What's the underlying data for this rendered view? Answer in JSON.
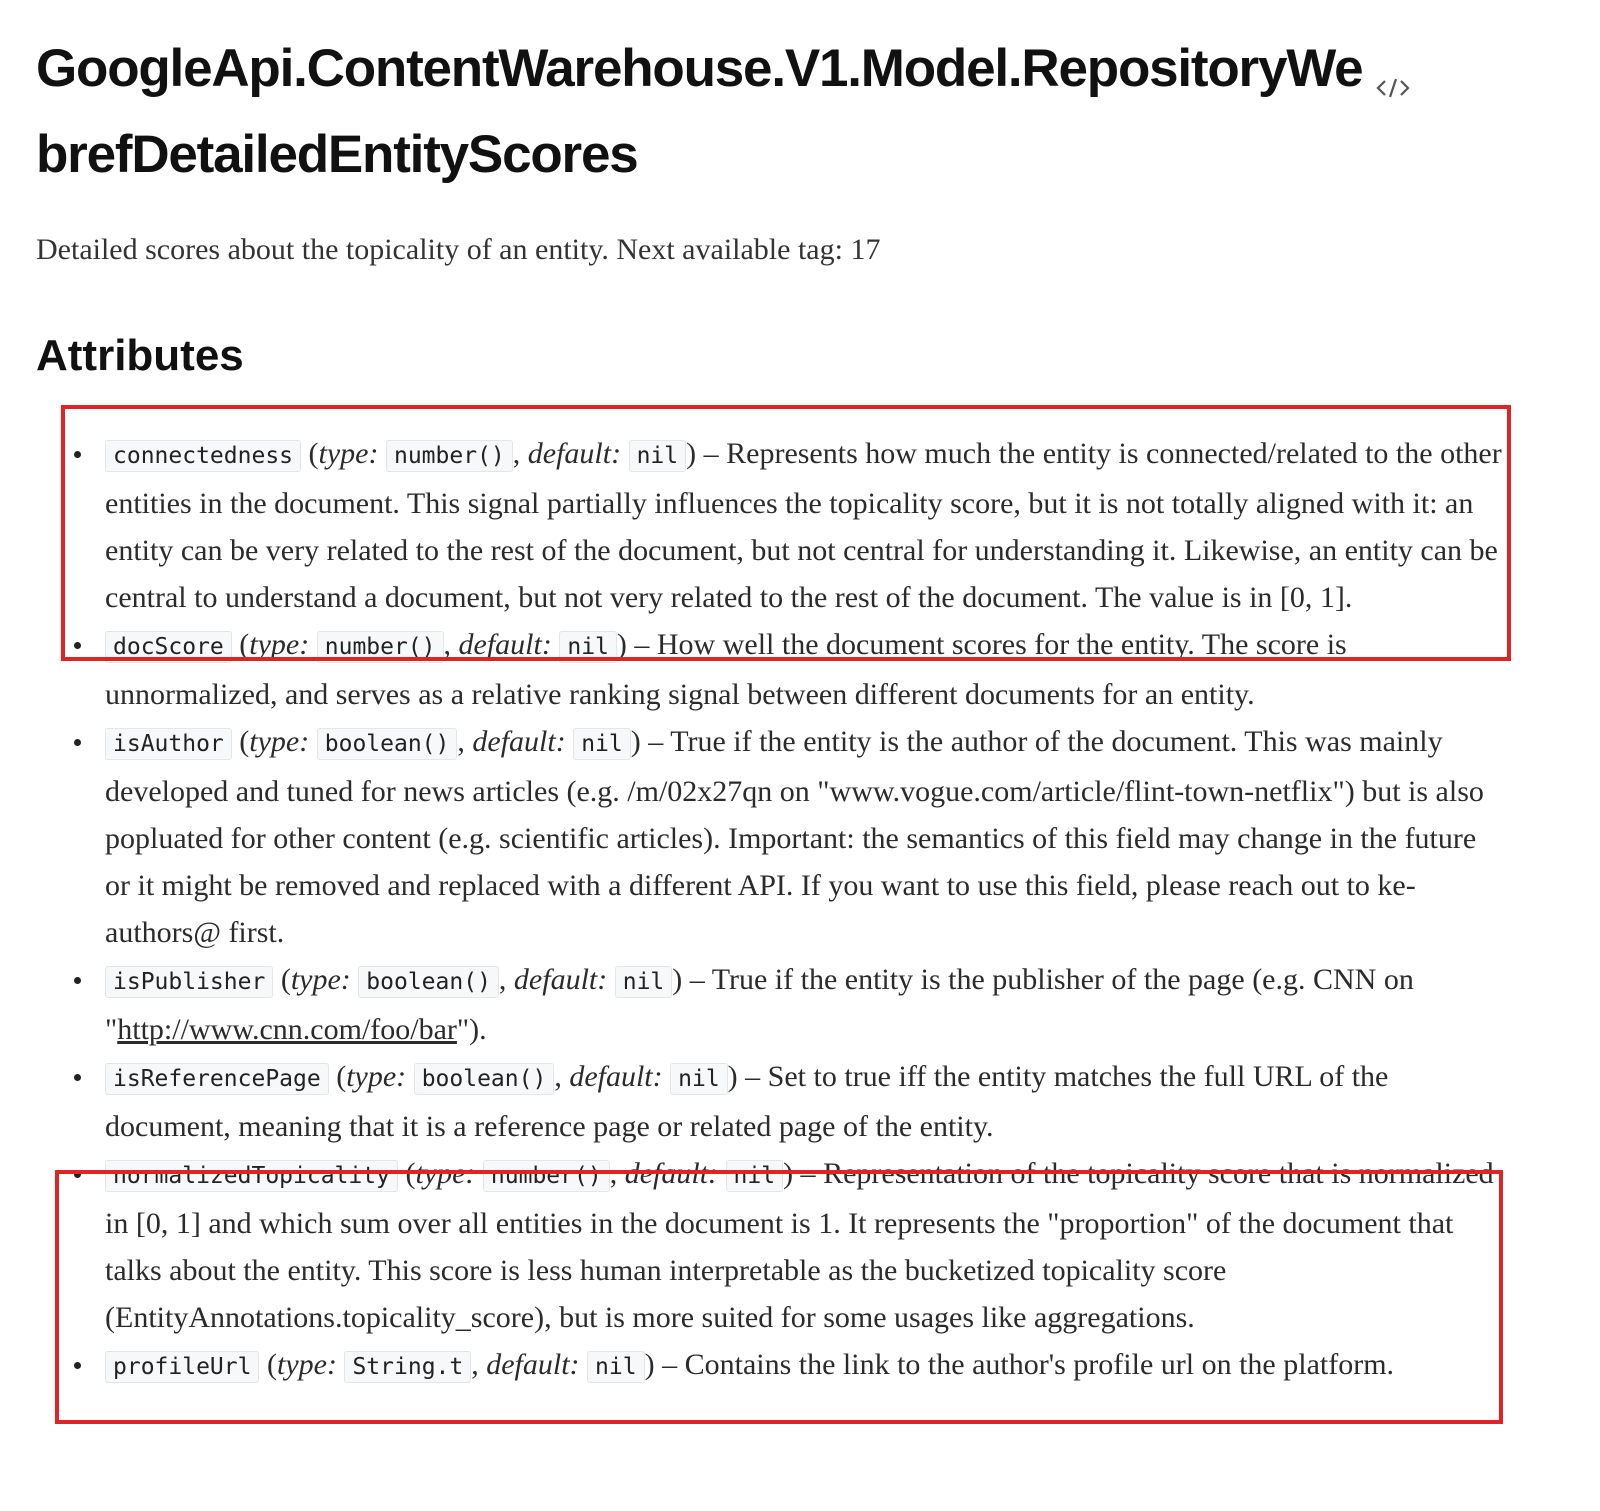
{
  "module": {
    "title_line1": "GoogleApi.ContentWarehouse.V1.Model.RepositoryWe",
    "title_line2": "brefDetailedEntityScores",
    "source_icon": "code-icon",
    "moduledoc": "Detailed scores about the topicality of an entity. Next available tag: 17"
  },
  "attributes_section": {
    "title": "Attributes",
    "type_label": "type:",
    "default_label": "default:",
    "items": [
      {
        "name": "connectedness",
        "type": "number()",
        "default": "nil",
        "description": "Represents how much the entity is connected/related to the other entities in the document. This signal partially influences the topicality score, but it is not totally aligned with it: an entity can be very related to the rest of the document, but not central for understanding it. Likewise, an entity can be central to understand a document, but not very related to the rest of the document. The value is in [0, 1]."
      },
      {
        "name": "docScore",
        "type": "number()",
        "default": "nil",
        "description": "How well the document scores for the entity. The score is unnormalized, and serves as a relative ranking signal between different documents for an entity."
      },
      {
        "name": "isAuthor",
        "type": "boolean()",
        "default": "nil",
        "description": "True if the entity is the author of the document. This was mainly developed and tuned for news articles (e.g. /m/02x27qn on \"www.vogue.com/article/flint-town-netflix\") but is also popluated for other content (e.g. scientific articles). Important: the semantics of this field may change in the future or it might be removed and replaced with a different API. If you want to use this field, please reach out to ke-authors@ first."
      },
      {
        "name": "isPublisher",
        "type": "boolean()",
        "default": "nil",
        "description_before_link": "True if the entity is the publisher of the page (e.g. CNN on \"",
        "link_text": "http://www.cnn.com/foo/bar",
        "description_after_link": "\")."
      },
      {
        "name": "isReferencePage",
        "type": "boolean()",
        "default": "nil",
        "description": "Set to true iff the entity matches the full URL of the document, meaning that it is a reference page or related page of the entity."
      },
      {
        "name": "normalizedTopicality",
        "type": "number()",
        "default": "nil",
        "description": "Representation of the topicality score that is normalized in [0, 1] and which sum over all entities in the document is 1. It represents the \"proportion\" of the document that talks about the entity. This score is less human interpretable as the bucketized topicality score (EntityAnnotations.topicality_score), but is more suited for some usages like aggregations."
      },
      {
        "name": "profileUrl",
        "type": "String.t",
        "default": "nil",
        "description": "Contains the link to the author's profile url on the platform."
      }
    ]
  },
  "annotation": {
    "highlight_color": "#e02424"
  }
}
